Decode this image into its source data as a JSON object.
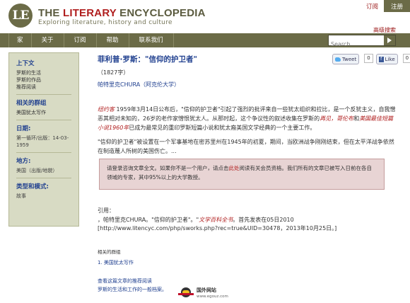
{
  "header": {
    "logo_mark": "LE",
    "title_part1": "THE ",
    "title_part2": "LITERARY",
    "title_part3": " ENCYCLOPEDIA",
    "tagline": "Exploring literature, history and culture",
    "subscribe": "订阅",
    "register": "注册"
  },
  "nav": {
    "items": [
      "家",
      "关于",
      "订阅",
      "帮助",
      "联系我们"
    ],
    "search_placeholder": "Search",
    "advanced_search": "高级搜索"
  },
  "sidebar": {
    "context_heading": "上下文",
    "context_links": [
      "罗斯的生活",
      "罗斯的作品",
      "推荐阅读"
    ],
    "groups_heading": "相关的群组",
    "groups_links": [
      "美国犹太写作"
    ],
    "date_heading": "日期:",
    "date_text": "第一循环/出版：14-03-1959",
    "place_heading": "地方:",
    "place_text": "美国（出版/地貌）",
    "type_heading": "类型和模式:",
    "type_text": "故事"
  },
  "article": {
    "title": "菲利普·罗斯：\"信仰的护卫者\"",
    "wordcount": "（1827字）",
    "author": "帕特里克CHURA",
    "affiliation": "（阿克伦大学）",
    "share": {
      "tweet_label": "Tweet",
      "tweet_count": "0",
      "like_label": "Like",
      "like_count": "0"
    },
    "p1_a": "纽约客",
    "p1_b": " 1959年3月14日公布后，\"信仰的护卫者\"引起了强烈的批评来自一些犹太组织和拉比，是一个反犹主义，自我憎恶其相对未知的，26岁的老作家憎恨犹太人。从那时起，这个争议性的叙述收集在罗斯的",
    "p1_c": "再见，哥伦布",
    "p1_d": "和",
    "p1_e": "美国最佳短篇小说1960年",
    "p1_f": "已成为最常见的重印罗斯短篇小说和犹太裔美国文学经典的一个主要工作。",
    "p2": "\"信仰的护卫者\"被设置在一个军事基地在密苏里州在1945年的初夏，期间，当欧洲战争刚刚结束，但在太平洋战争依然在制造蔑人所树的美国伤亡。...",
    "paywall_a": "请登录咨询文章全文。如果你不是一个用户，请点击",
    "paywall_link": "此处",
    "paywall_b": "阅读有关会员资格。我们所有的文章已被写入日前在各自领域的专家，其中95%以上的大学教授。",
    "cite_label": "引用：",
    "cite_a": "，帕特里克CHURA。\"信仰的护卫者\"。\"",
    "cite_ency": "文学百科全书",
    "cite_b": "。首先发表在05日2010 [http://www.litencyc.com/php/sworks.php?rec=true&UID=30478，2013年10月25日。]",
    "related_heading": "相关的群组",
    "related_item": "1. 美国犹太写作",
    "rec_line1": "查看这篇文章的推荐阅读",
    "rec_line2": "罗斯的生活和工作的一般档案。"
  },
  "watermark": {
    "text": "国外网站",
    "url": "www.egouz.com"
  },
  "colors": {
    "olive": "#6b6b47",
    "red": "#b01e1e",
    "blue": "#1f3f8f",
    "sidebar_bg": "#d8dbc4",
    "paywall_bg": "#e8d4d4"
  }
}
